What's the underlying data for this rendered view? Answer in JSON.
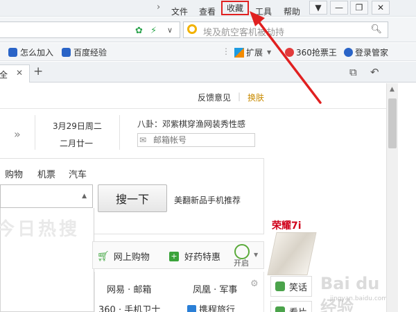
{
  "menu": {
    "file": "文件",
    "view": "查看",
    "favorites": "收藏",
    "tools": "工具",
    "help": "帮助"
  },
  "search": {
    "placeholder": "埃及航空客机被劫持"
  },
  "bookmarks": {
    "join": "怎么加入",
    "baidu_exp": "百度经验",
    "extensions": "扩展",
    "ticket": "360抢票王",
    "login_manager": "登录管家"
  },
  "tab": {
    "label": "全"
  },
  "page": {
    "feedback": "反馈意见",
    "skin": "换肤",
    "date": "3月29日周二",
    "lunar_date": "二月廿一",
    "gossip": "八卦：邓紫棋穿渔网装秀性感",
    "mail_placeholder": "邮箱帐号",
    "categories": [
      "购物",
      "机票",
      "汽车"
    ],
    "search_button": "搜一下",
    "promo": "美翻新品手机推荐",
    "hot_search": "今日热搜",
    "shortcuts": {
      "shopping": "网上购物",
      "medicine": "好药特惠",
      "open": "开启"
    },
    "sites": {
      "netease_mail": "网易 · 邮箱",
      "ifeng_military": "凤凰 · 军事",
      "guard": "360 · 手机卫士",
      "ctrip": "携程旅行"
    },
    "ad_title": "荣耀7i",
    "side": {
      "joke": "笑话",
      "second": "看片"
    }
  },
  "watermark": {
    "main": "Bai du 经验",
    "sub": "jingyan.baidu.com"
  },
  "colors": {
    "annotation_red": "#e02020",
    "skin_link": "#c88a00",
    "accent_green": "#3aa33a"
  }
}
